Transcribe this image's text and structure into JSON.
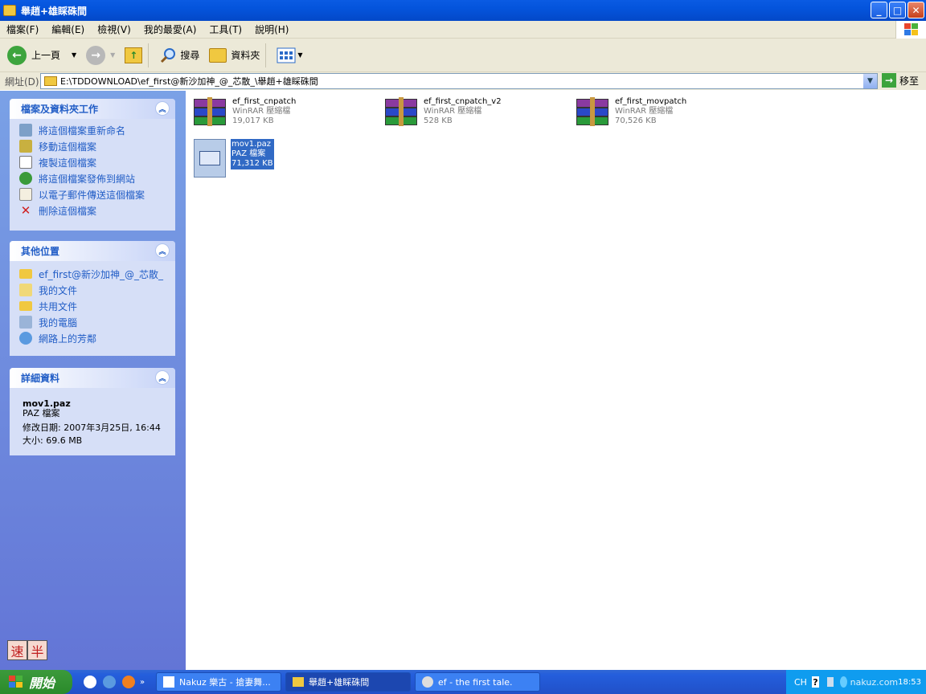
{
  "window": {
    "title": "舉趙+雄睬硃間",
    "min": "_",
    "max": "□",
    "close": "✕"
  },
  "menu": [
    "檔案(F)",
    "編輯(E)",
    "檢視(V)",
    "我的最愛(A)",
    "工具(T)",
    "說明(H)"
  ],
  "toolbar": {
    "back": "上一頁",
    "search": "搜尋",
    "folders": "資料夾"
  },
  "address": {
    "label": "網址(D)",
    "path": "E:\\TDDOWNLOAD\\ef_first@新沙加神_@_芯散_\\舉趙+雄睬硃間",
    "go": "移至"
  },
  "tasks_panel": {
    "title": "檔案及資料夾工作",
    "items": [
      "將這個檔案重新命名",
      "移動這個檔案",
      "複製這個檔案",
      "將這個檔案發佈到網站",
      "以電子郵件傳送這個檔案",
      "刪除這個檔案"
    ]
  },
  "places_panel": {
    "title": "其他位置",
    "items": [
      "ef_first@新沙加神_@_芯散_",
      "我的文件",
      "共用文件",
      "我的電腦",
      "網路上的芳鄰"
    ]
  },
  "details_panel": {
    "title": "詳細資料",
    "name": "mov1.paz",
    "type": "PAZ 檔案",
    "modified": "修改日期: 2007年3月25日, 16:44",
    "size": "大小: 69.6 MB"
  },
  "files": [
    {
      "name": "ef_first_cnpatch",
      "type": "WinRAR 壓縮檔",
      "size": "19,017 KB"
    },
    {
      "name": "ef_first_cnpatch_v2",
      "type": "WinRAR 壓縮檔",
      "size": "528 KB"
    },
    {
      "name": "ef_first_movpatch",
      "type": "WinRAR 壓縮檔",
      "size": "70,526 KB"
    },
    {
      "name": "mov1.paz",
      "type": "PAZ 檔案",
      "size": "71,312 KB"
    }
  ],
  "ime": [
    "速",
    "半"
  ],
  "taskbar": {
    "start": "開始",
    "tasks": [
      "Nakuz 樂古 - 搶妻舞...",
      "舉趙+雄睬硃間",
      "ef - the first tale."
    ],
    "lang": "CH",
    "help": "?",
    "clock": "18:53",
    "watermark": "nakuz.com"
  }
}
